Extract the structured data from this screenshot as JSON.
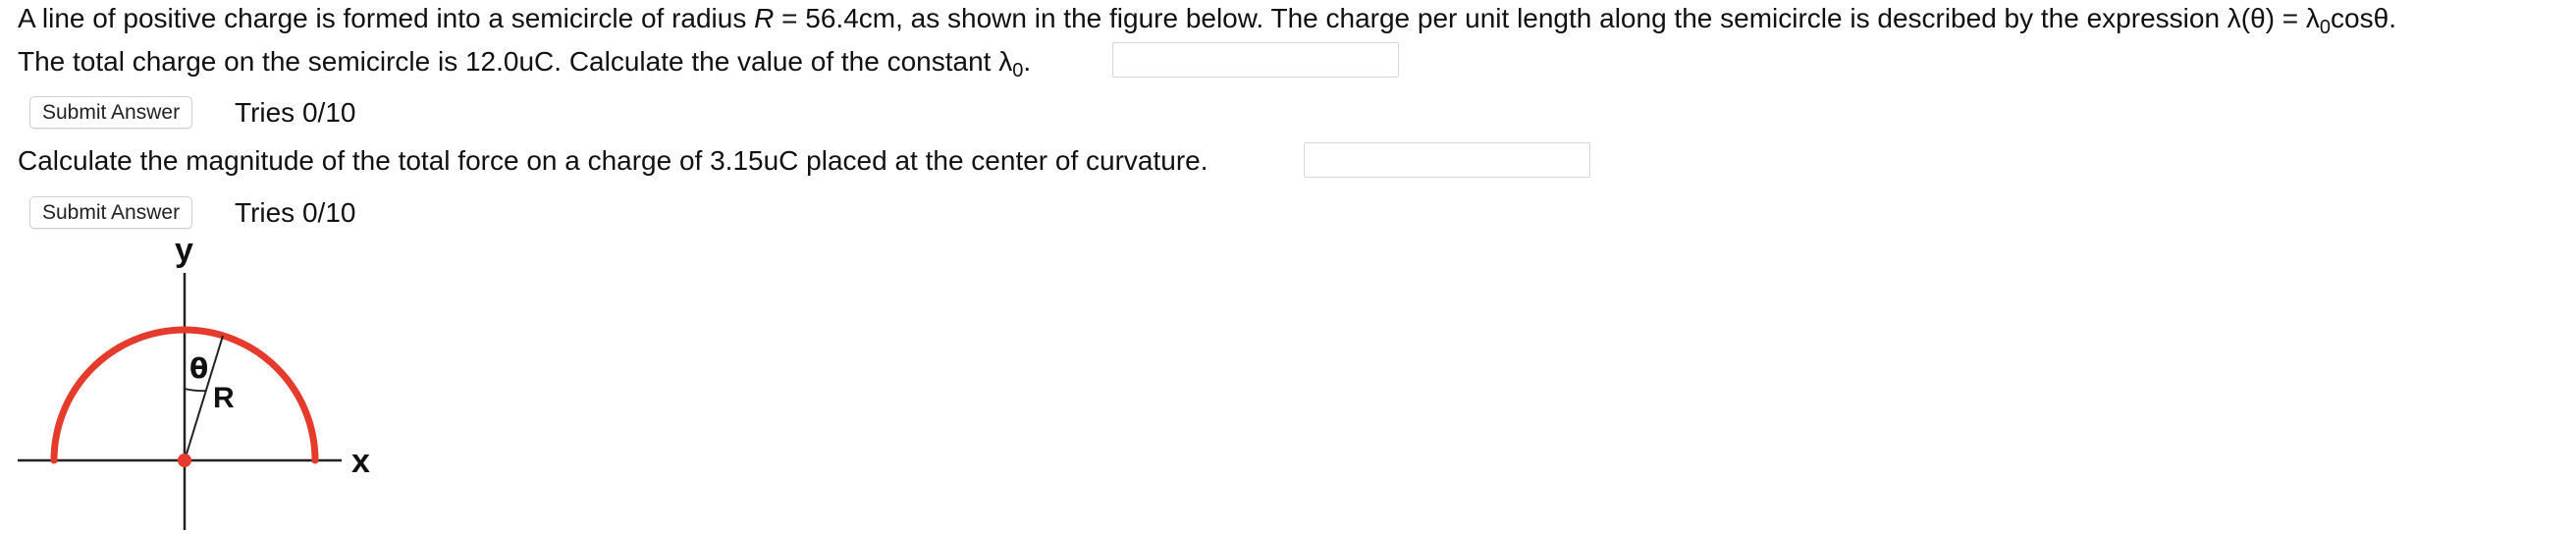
{
  "question1": {
    "line1_prefix": "A line of positive charge is formed into a semicircle of radius ",
    "radius_symbol": "R",
    "line1_mid": " = 56.4cm, as shown in the figure below. The charge per unit length along the semicircle is described by the expression λ(θ) = λ",
    "lambda_sub": "0",
    "line1_suffix": "cosθ.",
    "line2_prefix": "The total charge on the semicircle is 12.0uC. Calculate the value of the constant λ",
    "line2_sub": "0",
    "line2_suffix": ".",
    "input_value": "",
    "submit_label": "Submit Answer",
    "tries": "Tries 0/10"
  },
  "question2": {
    "text": "Calculate the magnitude of the total force on a charge of 3.15uC placed at the center of curvature.",
    "input_value": "",
    "submit_label": "Submit Answer",
    "tries": "Tries 0/10"
  },
  "figure": {
    "y_label": "y",
    "x_label": "x",
    "theta_label": "θ",
    "r_label": "R",
    "arc_color": "#e53b2c",
    "axis_color": "#222222"
  }
}
